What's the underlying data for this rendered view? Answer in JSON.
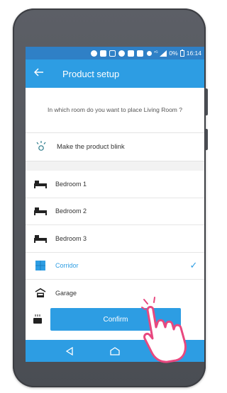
{
  "status_bar": {
    "battery_percent": "0%",
    "time": "16:14"
  },
  "app_bar": {
    "back_icon": "back-arrow-icon",
    "title": "Product setup"
  },
  "prompt": {
    "text": "In which room do you want to place Living Room ?"
  },
  "blink_action": {
    "icon": "light-bulb-icon",
    "label": "Make the product blink"
  },
  "rooms": [
    {
      "label": "Bedroom 1",
      "icon": "bed-icon",
      "selected": false
    },
    {
      "label": "Bedroom 2",
      "icon": "bed-icon",
      "selected": false
    },
    {
      "label": "Bedroom 3",
      "icon": "bed-icon",
      "selected": false
    },
    {
      "label": "Corridor",
      "icon": "corridor-icon",
      "selected": true
    },
    {
      "label": "Garage",
      "icon": "garage-icon",
      "selected": false
    }
  ],
  "confirm": {
    "label": "Confirm"
  },
  "colors": {
    "accent": "#2d9de3",
    "status_bar": "#2f80c6",
    "phone_body": "#4f5258"
  }
}
